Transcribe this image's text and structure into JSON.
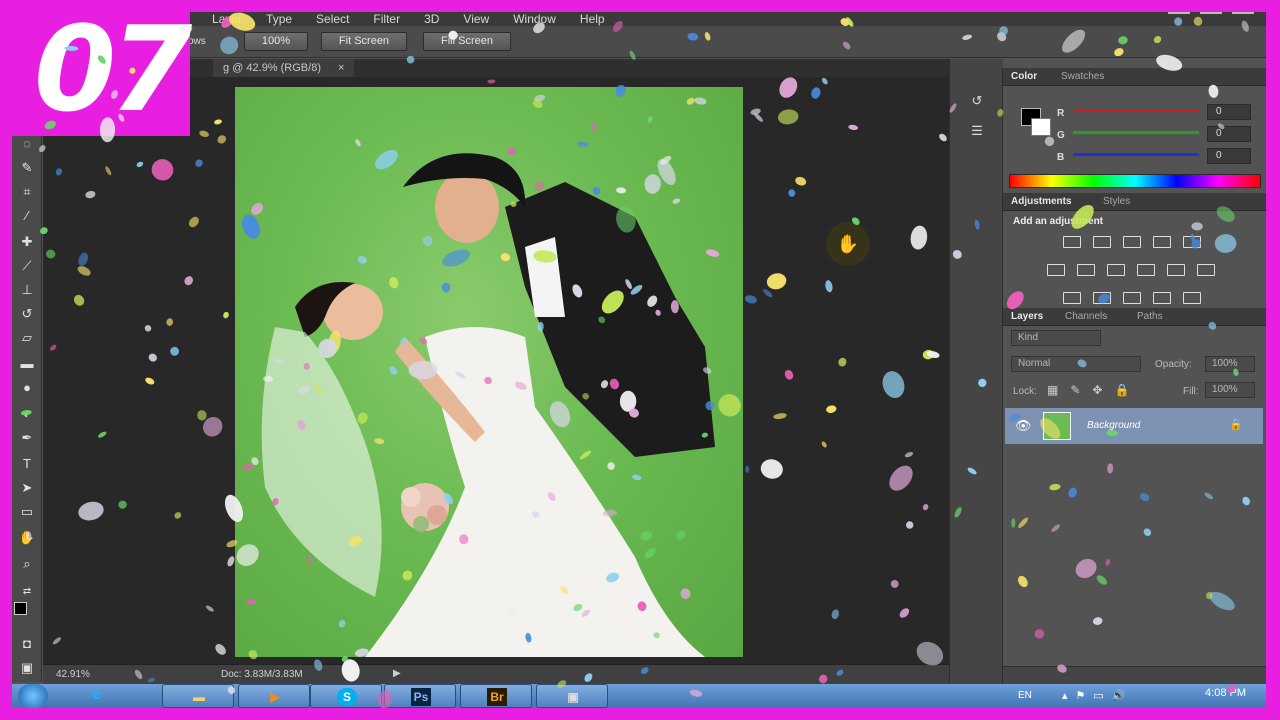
{
  "badge": {
    "text": "07"
  },
  "menubar": {
    "items": [
      "Layer",
      "Type",
      "Select",
      "Filter",
      "3D",
      "View",
      "Window",
      "Help"
    ]
  },
  "options_bar": {
    "label": "ows",
    "zoom_button": "100%",
    "fit_screen_button": "Fit Screen",
    "fill_screen_button": "Fill Screen"
  },
  "document": {
    "tab_title": "g @ 42.9% (RGB/8)"
  },
  "status_bar": {
    "zoom": "42.91%",
    "doc_size": "Doc: 3.83M/3.83M"
  },
  "color_panel": {
    "tabs": [
      "Color",
      "Swatches"
    ],
    "channels": [
      {
        "label": "R",
        "value": "0",
        "color": "#d22020"
      },
      {
        "label": "G",
        "value": "0",
        "color": "#1da31d"
      },
      {
        "label": "B",
        "value": "0",
        "color": "#2030d0"
      }
    ]
  },
  "adjustments_panel": {
    "tabs": [
      "Adjustments",
      "Styles"
    ],
    "heading": "Add an adjustment",
    "icons": [
      "brightness-contrast-icon",
      "levels-icon",
      "curves-icon",
      "exposure-icon",
      "vibrance-icon",
      "hue-saturation-icon",
      "color-balance-icon",
      "black-white-icon",
      "photo-filter-icon",
      "channel-mixer-icon",
      "color-lookup-icon",
      "invert-icon",
      "posterize-icon",
      "threshold-icon",
      "selective-color-icon",
      "gradient-map-icon"
    ]
  },
  "layers_panel": {
    "tabs": [
      "Layers",
      "Channels",
      "Paths"
    ],
    "kind_filter": "Kind",
    "blend_mode": "Normal",
    "opacity_label": "Opacity:",
    "opacity_value": "100%",
    "lock_label": "Lock:",
    "fill_label": "Fill:",
    "fill_value": "100%",
    "layers": [
      {
        "name": "Background",
        "visible": true,
        "locked": true
      }
    ]
  },
  "taskbar": {
    "apps": [
      "Internet Explorer",
      "Windows Explorer",
      "Media Player",
      "Skype",
      "Photoshop",
      "Bridge",
      "Image Viewer"
    ],
    "language": "EN",
    "time": "4:08 PM"
  },
  "colors": {
    "accent": "#e81ee0",
    "panel": "#535353",
    "selected_layer": "#7d91b2"
  }
}
